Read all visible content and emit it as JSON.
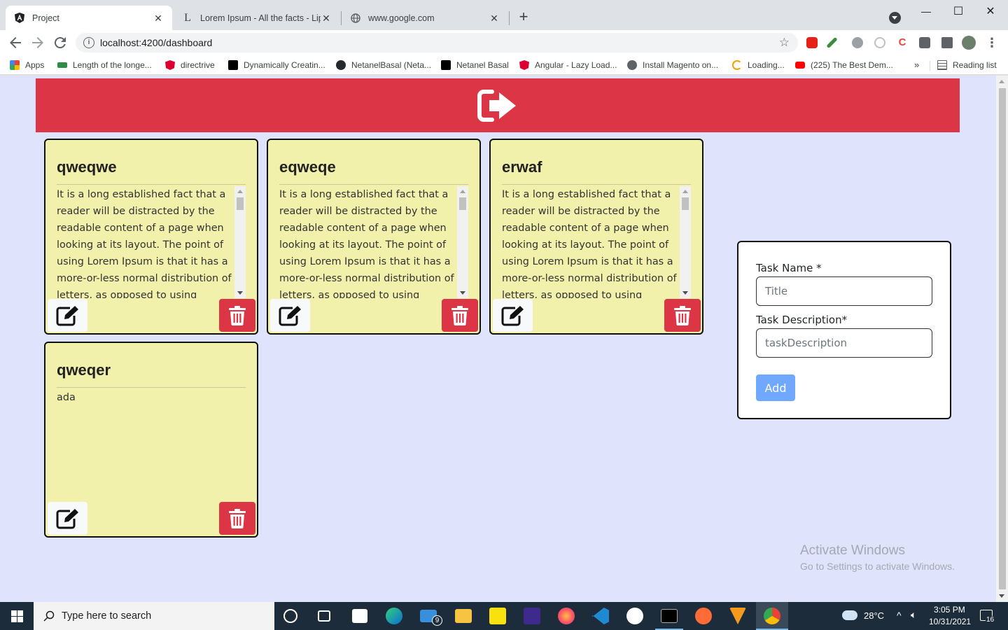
{
  "browser": {
    "tabs": [
      {
        "title": "Project",
        "close": "✕"
      },
      {
        "title": "Lorem Ipsum - All the facts - Lips",
        "close": "✕"
      },
      {
        "title": "www.google.com",
        "close": "✕"
      }
    ],
    "new_tab": "+",
    "url": "localhost:4200/dashboard",
    "window_controls": {
      "minimize": "—",
      "maximize": "☐",
      "close": "✕"
    },
    "bookmarks": [
      {
        "label": "Apps",
        "icon": "apps-grid-icon",
        "color": "#ea4335"
      },
      {
        "label": "Length of the longe...",
        "icon": "geeks-icon",
        "color": "#2f8d46"
      },
      {
        "label": "directrive",
        "icon": "angular-icon",
        "color": "#dd0031"
      },
      {
        "label": "Dynamically Creatin...",
        "icon": "dev-icon",
        "color": "#000000"
      },
      {
        "label": "NetanelBasal (Neta...",
        "icon": "github-icon",
        "color": "#24292e"
      },
      {
        "label": "Netanel Basal",
        "icon": "dev-icon",
        "color": "#000000"
      },
      {
        "label": "Angular - Lazy Load...",
        "icon": "angular-icon",
        "color": "#dd0031"
      },
      {
        "label": "Install Magento on...",
        "icon": "globe-icon",
        "color": "#5f6368"
      },
      {
        "label": "Loading...",
        "icon": "loading-icon",
        "color": "#f4a100"
      },
      {
        "label": "(225) The Best Dem...",
        "icon": "youtube-icon",
        "color": "#ff0000"
      }
    ],
    "more_bookmarks": "»",
    "reading_list": "Reading list"
  },
  "tasks": [
    {
      "title": "qweqwe",
      "description": "It is a long established fact that a reader will be distracted by the readable content of a page when looking at its layout. The point of using Lorem Ipsum is that it has a more-or-less normal distribution of letters, as opposed to using",
      "scrollable": true
    },
    {
      "title": "eqweqe",
      "description": "It is a long established fact that a reader will be distracted by the readable content of a page when looking at its layout. The point of using Lorem Ipsum is that it has a more-or-less normal distribution of letters, as opposed to using",
      "scrollable": true
    },
    {
      "title": "erwaf",
      "description": "It is a long established fact that a reader will be distracted by the readable content of a page when looking at its layout. The point of using Lorem Ipsum is that it has a more-or-less normal distribution of letters, as opposed to using",
      "scrollable": true
    },
    {
      "title": "qweqer",
      "description": "ada",
      "scrollable": false
    }
  ],
  "form": {
    "name_label": "Task Name *",
    "name_placeholder": "Title",
    "desc_label": "Task Description*",
    "desc_placeholder": "taskDescription",
    "add_label": "Add"
  },
  "watermark": {
    "line1": "Activate Windows",
    "line2": "Go to Settings to activate Windows."
  },
  "taskbar": {
    "search_placeholder": "Type here to search",
    "mail_badge": "9",
    "temperature": "28°C",
    "time": "3:05 PM",
    "date": "10/31/2021",
    "notification_count": "16"
  },
  "colors": {
    "danger": "#dc3545",
    "card_bg": "#f2f1ab",
    "page_bg": "#dfe3fb",
    "primary_disabled": "#70a8fd"
  }
}
